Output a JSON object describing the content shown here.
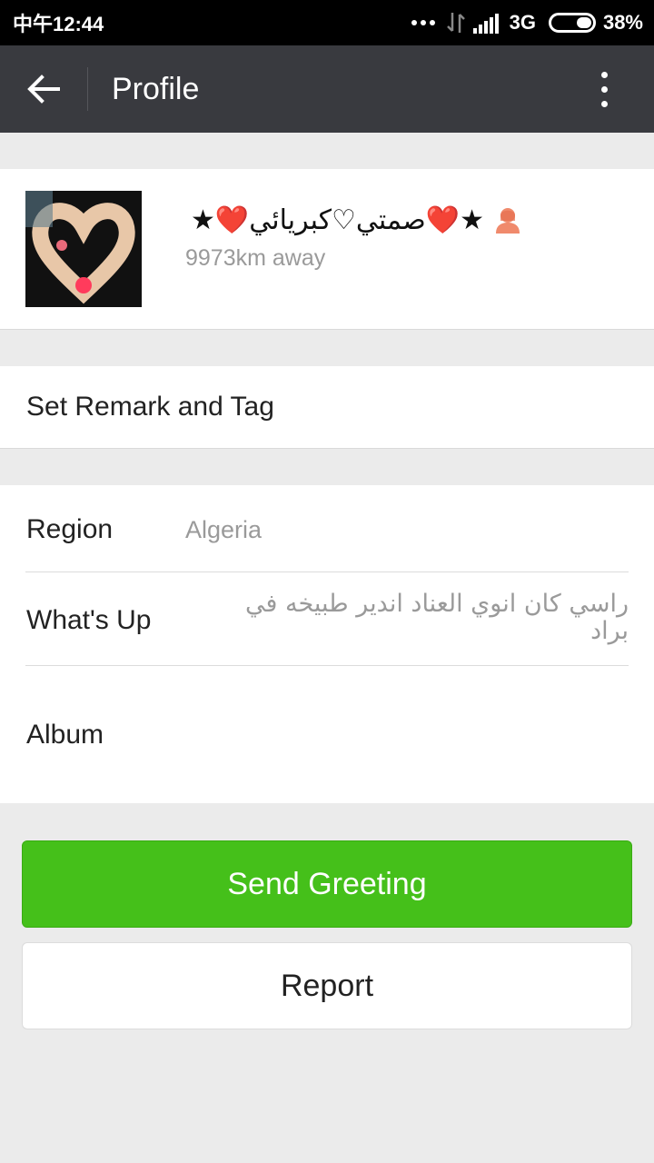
{
  "status_bar": {
    "time": "中午12:44",
    "network": "3G",
    "battery": "38%"
  },
  "app_bar": {
    "title": "Profile"
  },
  "profile": {
    "name": "★❤️صمتي♡كبريائي❤️★",
    "distance": "9973km away",
    "gender_icon": "female-user-icon"
  },
  "remark": {
    "label": "Set Remark and Tag"
  },
  "info": {
    "region_label": "Region",
    "region_value": "Algeria",
    "whatsup_label": "What's Up",
    "whatsup_value": "راسي كان انوي العناد اندير طبيخه في براد",
    "album_label": "Album"
  },
  "buttons": {
    "send_greeting": "Send Greeting",
    "report": "Report"
  },
  "colors": {
    "appbar": "#393a3f",
    "accent_green": "#45c01a",
    "background": "#ebebeb"
  }
}
